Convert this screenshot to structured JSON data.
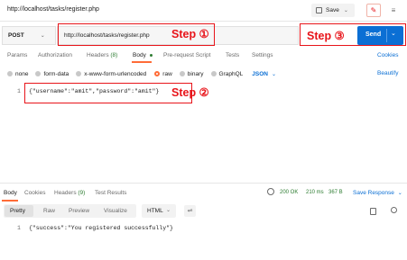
{
  "header": {
    "title": "http://localhost/tasks/register.php",
    "save_label": "Save"
  },
  "request": {
    "method": "POST",
    "url": "http://localhost/tasks/register.php",
    "send_label": "Send"
  },
  "annotations": {
    "step1": "Step ①",
    "step2": "Step ②",
    "step3": "Step ③"
  },
  "request_tabs": {
    "params": "Params",
    "authorization": "Authorization",
    "headers": "Headers",
    "headers_count": "(8)",
    "body": "Body",
    "prerequest": "Pre-request Script",
    "tests": "Tests",
    "settings": "Settings",
    "cookies": "Cookies"
  },
  "body_types": {
    "none": "none",
    "form_data": "form-data",
    "urlencoded": "x-www-form-urlencoded",
    "raw": "raw",
    "binary": "binary",
    "graphql": "GraphQL",
    "format": "JSON",
    "beautify": "Beautify"
  },
  "editor": {
    "line_number": "1",
    "content": "{\"username\":\"amit\",\"password\":\"amit\"}"
  },
  "response_tabs": {
    "body": "Body",
    "cookies": "Cookies",
    "headers": "Headers",
    "headers_count": "(9)",
    "test_results": "Test Results",
    "status": "200 OK",
    "time": "210 ms",
    "size": "367 B",
    "save_response": "Save Response"
  },
  "response_view": {
    "pretty": "Pretty",
    "raw": "Raw",
    "preview": "Preview",
    "visualize": "Visualize",
    "format": "HTML"
  },
  "response_body": {
    "line_number": "1",
    "content": "{\"success\":\"You registered successfully\"}"
  },
  "colors": {
    "send_button": "#0b6fd4",
    "accent": "#ff6c37",
    "annotation": "#e8141a",
    "status_ok": "#2e7d32"
  }
}
